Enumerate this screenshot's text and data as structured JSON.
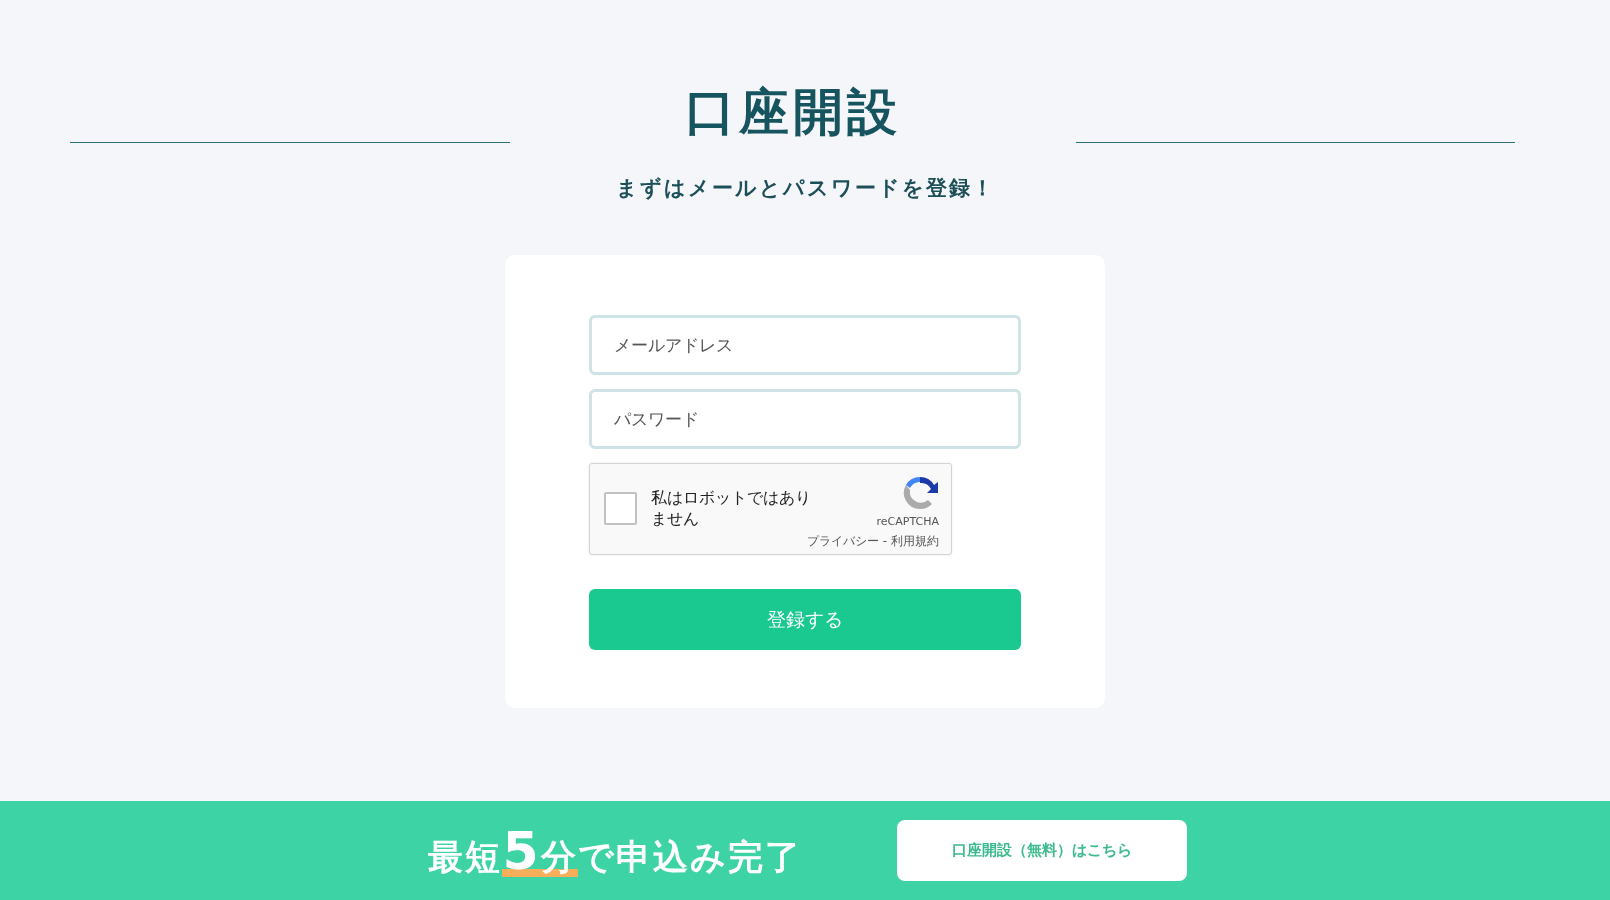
{
  "heading": {
    "title": "口座開設",
    "subtitle": "まずはメールとパスワードを登録！"
  },
  "form": {
    "fields": [
      {
        "placeholder": "メールアドレス"
      },
      {
        "placeholder": "パスワード"
      }
    ],
    "captcha": {
      "label": "私はロボットではありません",
      "checked": false,
      "brand": "reCAPTCHA",
      "privacy": "プライバシー",
      "separator": "-",
      "terms": "利用規約"
    },
    "submit": "登録する"
  },
  "footer": {
    "tagline": {
      "lead": "最短",
      "number": "5",
      "unit": "分",
      "rest": "で申込み完了"
    },
    "button": "口座開設（無料）はこちら"
  }
}
